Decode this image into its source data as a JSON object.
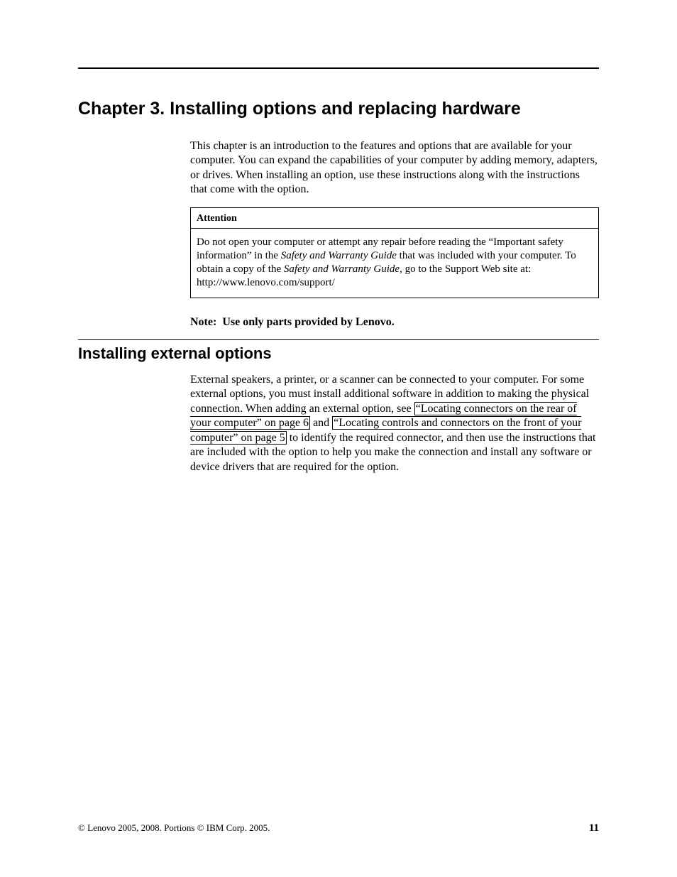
{
  "chapter": {
    "title": "Chapter 3. Installing options and replacing hardware",
    "intro": "This chapter is an introduction to the features and options that are available for your computer. You can expand the capabilities of your computer by adding memory, adapters, or drives. When installing an option, use these instructions along with the instructions that come with the option."
  },
  "attention": {
    "label": "Attention",
    "text_before": "Do not open your computer or attempt any repair before reading the “Important safety information” in the ",
    "guide_ref_1": "Safety and Warranty Guide",
    "text_mid": " that was included with your computer. To obtain a copy of the ",
    "guide_ref_2": "Safety and Warranty Guide",
    "text_after": ", go to the Support Web site at: http://www.lenovo.com/support/"
  },
  "note": {
    "label": "Note:",
    "text": "Use only parts provided by Lenovo."
  },
  "section": {
    "title": "Installing external options",
    "para_pre": "External speakers, a printer, or a scanner can be connected to your computer. For some external options, you must install additional software in addition to making the physical connection. When adding an external option, see ",
    "link1": "“Locating connectors on the rear of your computer” on page 6",
    "para_mid": " and ",
    "link2": "“Locating controls and connectors on the front of your computer” on page 5",
    "para_post": " to identify the required connector, and then use the instructions that are included with the option to help you make the connection and install any software or device drivers that are required for the option."
  },
  "footer": {
    "copyright": "© Lenovo 2005, 2008. Portions © IBM Corp. 2005.",
    "page": "11"
  }
}
